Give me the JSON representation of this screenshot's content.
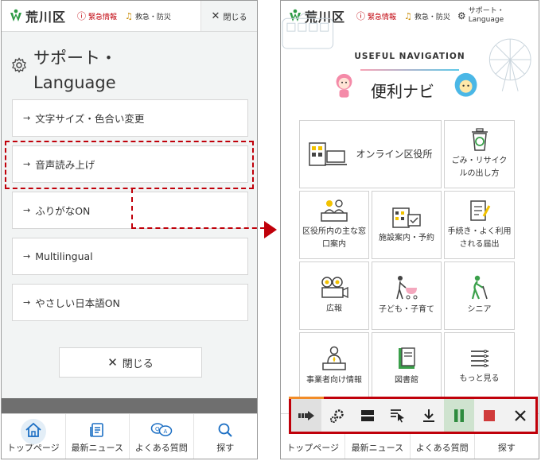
{
  "brand": {
    "name": "荒川区"
  },
  "left_screen": {
    "header": {
      "emergency": "緊急情報",
      "disaster": "救急・防災",
      "close": "閉じる"
    },
    "panel_title_line1": "サポート・",
    "panel_title_line2": "Language",
    "menu_items": [
      {
        "label": "文字サイズ・色合い変更"
      },
      {
        "label": "音声読み上げ"
      },
      {
        "label": "ふりがなON"
      },
      {
        "label": "Multilingual"
      },
      {
        "label": "やさしい日本語ON"
      }
    ],
    "close_button": "閉じる"
  },
  "right_screen": {
    "header": {
      "emergency": "緊急情報",
      "disaster": "救急・防災",
      "support_line1": "サポート・",
      "support_line2": "Language"
    },
    "nav_title": "USEFUL NAVIGATION",
    "nav_subtitle": "便利ナビ",
    "tiles": [
      {
        "label": "オンライン区役所",
        "icon": "online-office-icon"
      },
      {
        "label": "ごみ・リサイクルの出し方",
        "icon": "recycle-bin-icon"
      },
      {
        "label": "区役所内の主な窓口案内",
        "icon": "counter-icon"
      },
      {
        "label": "施設案内・予約",
        "icon": "facility-calendar-icon"
      },
      {
        "label": "手続き・よく利用される届出",
        "icon": "form-icon"
      },
      {
        "label": "広報",
        "icon": "camera-icon"
      },
      {
        "label": "子ども・子育て",
        "icon": "stroller-icon"
      },
      {
        "label": "シニア",
        "icon": "senior-icon"
      },
      {
        "label": "事業者向け情報",
        "icon": "business-icon"
      },
      {
        "label": "図書館",
        "icon": "book-icon"
      },
      {
        "label": "もっと見る",
        "icon": "list-icon"
      }
    ]
  },
  "bottom_nav": [
    {
      "label": "トップページ",
      "icon": "home-icon"
    },
    {
      "label": "最新ニュース",
      "icon": "news-icon"
    },
    {
      "label": "よくある質問",
      "icon": "faq-icon"
    },
    {
      "label": "探す",
      "icon": "search-icon"
    }
  ],
  "tts_toolbar": [
    "play-icon",
    "settings-icon",
    "layout-icon",
    "select-text-icon",
    "download-icon",
    "pause-icon",
    "stop-icon",
    "close-icon"
  ],
  "colors": {
    "highlight": "#c0000a",
    "emergency": "#c0000a",
    "active_blue": "#1c6fc4",
    "logo_green": "#2e9b46"
  }
}
